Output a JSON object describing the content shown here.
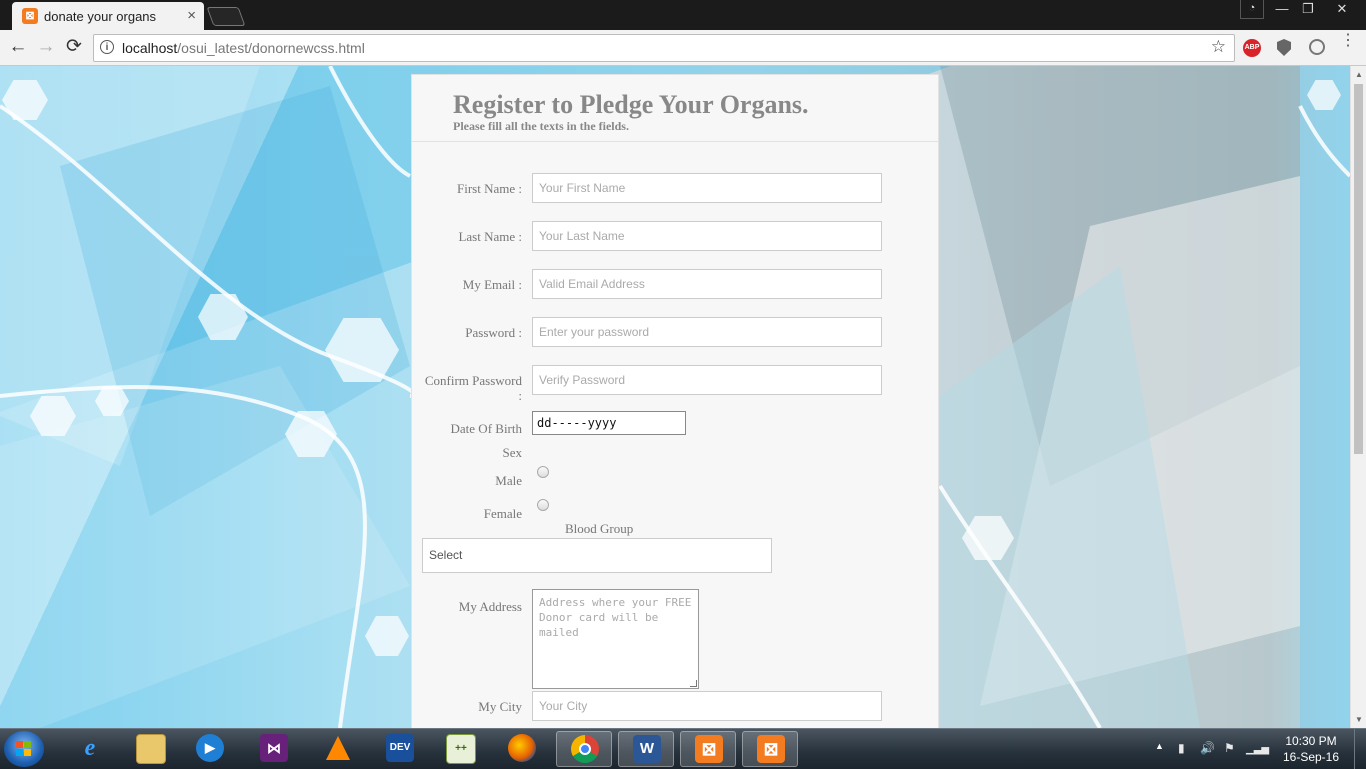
{
  "browser": {
    "tab_title": "donate your organs",
    "tab_close": "×",
    "url_host": "localhost",
    "url_path": "/osui_latest/donornewcss.html",
    "star_icon": "☆",
    "abp_label": "ABP",
    "window_controls": {
      "minimize": "—",
      "maximize": "❐",
      "close": "✕",
      "user": "👤"
    },
    "nav": {
      "back": "←",
      "forward": "→",
      "reload": "⟳",
      "menu": "⋮"
    }
  },
  "form": {
    "title": "Register to Pledge Your Organs.",
    "subtitle": "Please fill all the texts in the fields.",
    "first_name": {
      "label": "First Name :",
      "placeholder": "Your First Name"
    },
    "last_name": {
      "label": "Last Name :",
      "placeholder": "Your Last Name"
    },
    "email": {
      "label": "My Email :",
      "placeholder": "Valid Email Address"
    },
    "password": {
      "label": "Password :",
      "placeholder": "Enter your password"
    },
    "confirm_password": {
      "label": "Confirm Password",
      "label_suffix": ":",
      "placeholder": "Verify Password"
    },
    "dob": {
      "label": "Date Of Birth",
      "value": "dd-----yyyy"
    },
    "sex": {
      "label": "Sex",
      "options": [
        "Male",
        "Female"
      ]
    },
    "blood_group": {
      "label": "Blood Group",
      "value": "Select"
    },
    "address": {
      "label": "My Address",
      "placeholder": "Address where your FREE Donor card will be mailed"
    },
    "city": {
      "label": "My City",
      "placeholder": "Your City"
    }
  },
  "taskbar": {
    "clock_time": "10:30 PM",
    "clock_date": "16-Sep-16",
    "apps": [
      "internet-explorer",
      "file-explorer",
      "media-player",
      "visual-studio",
      "vlc",
      "dev-cpp",
      "notepad-plus-plus",
      "firefox",
      "chrome",
      "word",
      "xampp",
      "xampp"
    ],
    "dev_label": "DEV",
    "word_label": "W"
  },
  "colors": {
    "tab_favicon": "#f37b20",
    "abp_red": "#d8232a",
    "label_gray": "#777777",
    "title_gray": "#888888"
  }
}
